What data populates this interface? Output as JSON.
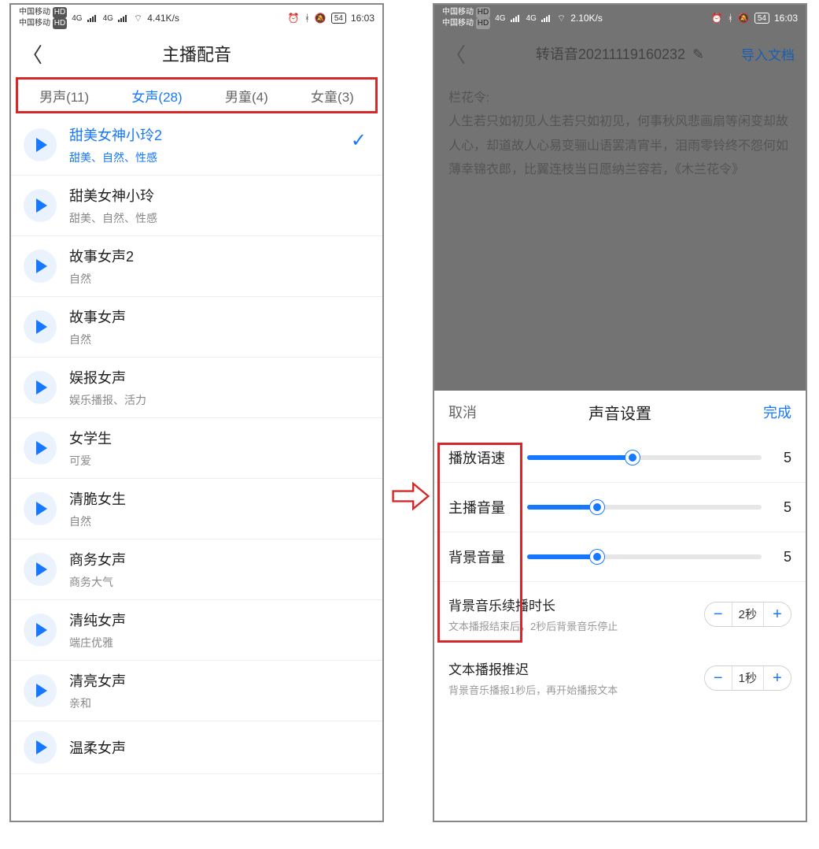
{
  "status": {
    "carrier_line1": "中国移动",
    "carrier_line2": "中国移动",
    "hd": "HD",
    "net1": "4G",
    "net2": "4G",
    "speed_left": "4.41K/s",
    "speed_right": "2.10K/s",
    "battery": "54",
    "time": "16:03"
  },
  "left": {
    "title": "主播配音",
    "tabs": [
      {
        "label": "男声(11)",
        "active": false
      },
      {
        "label": "女声(28)",
        "active": true
      },
      {
        "label": "男童(4)",
        "active": false
      },
      {
        "label": "女童(3)",
        "active": false
      }
    ],
    "voices": [
      {
        "name": "甜美女神小玲2",
        "tags": "甜美、自然、性感",
        "active": true
      },
      {
        "name": "甜美女神小玲",
        "tags": "甜美、自然、性感",
        "active": false
      },
      {
        "name": "故事女声2",
        "tags": "自然",
        "active": false
      },
      {
        "name": "故事女声",
        "tags": "自然",
        "active": false
      },
      {
        "name": "娱报女声",
        "tags": "娱乐播报、活力",
        "active": false
      },
      {
        "name": "女学生",
        "tags": "可爱",
        "active": false
      },
      {
        "name": "清脆女生",
        "tags": "自然",
        "active": false
      },
      {
        "name": "商务女声",
        "tags": "商务大气",
        "active": false
      },
      {
        "name": "清纯女声",
        "tags": "端庄优雅",
        "active": false
      },
      {
        "name": "清亮女声",
        "tags": "亲和",
        "active": false
      },
      {
        "name": "温柔女声",
        "tags": "",
        "active": false
      }
    ]
  },
  "right": {
    "title": "转语音20211119160232",
    "import": "导入文档",
    "body_label": "栏花令:",
    "body_text": "人生若只如初见人生若只如初见，何事秋风悲画扇等闲变却故人心，却道故人心易变骊山语罢清宵半，泪雨零铃终不怨何如薄幸锦衣郎，比翼连枝当日愿纳兰容若，《木兰花令》",
    "sheet": {
      "cancel": "取消",
      "title": "声音设置",
      "done": "完成",
      "sliders": [
        {
          "label": "播放语速",
          "value": 5,
          "max": 10,
          "fill_pct": 45
        },
        {
          "label": "主播音量",
          "value": 5,
          "max": 10,
          "fill_pct": 30
        },
        {
          "label": "背景音量",
          "value": 5,
          "max": 10,
          "fill_pct": 30
        }
      ],
      "steppers": [
        {
          "title": "背景音乐续播时长",
          "desc": "文本播报结束后，2秒后背景音乐停止",
          "value": "2秒"
        },
        {
          "title": "文本播报推迟",
          "desc": "背景音乐播报1秒后，再开始播报文本",
          "value": "1秒"
        }
      ]
    }
  }
}
